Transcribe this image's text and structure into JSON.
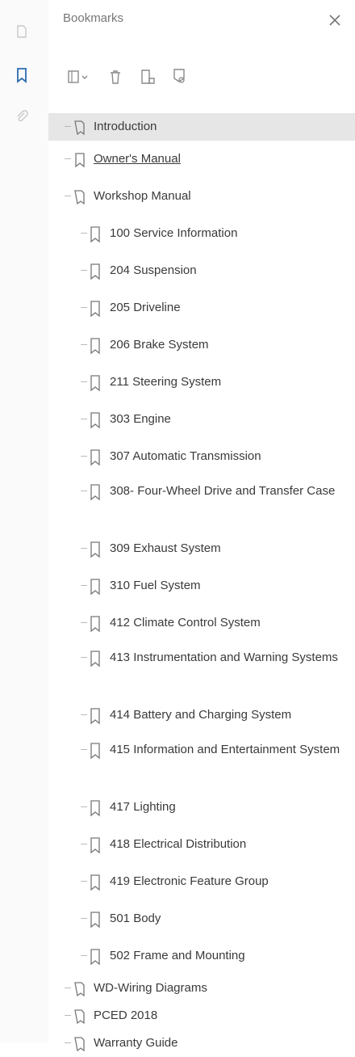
{
  "panel": {
    "title": "Bookmarks",
    "close_icon": "close-icon"
  },
  "rail": {
    "items": [
      {
        "icon": "page-thumbnail-icon"
      },
      {
        "icon": "bookmark-icon"
      },
      {
        "icon": "attachment-icon"
      }
    ]
  },
  "toolbar": {
    "buttons": [
      {
        "icon": "options-menu-icon"
      },
      {
        "icon": "delete-bookmark-icon"
      },
      {
        "icon": "new-bookmark-icon"
      },
      {
        "icon": "find-bookmark-icon"
      }
    ]
  },
  "tree": {
    "top": [
      {
        "label": "Introduction",
        "selected": true
      },
      {
        "label": "Owner's Manual",
        "underlined": true
      },
      {
        "label": "Workshop Manual",
        "expanded": true
      }
    ],
    "workshop_children": [
      "100 Service Information",
      "204 Suspension",
      "205 Driveline",
      "206 Brake System",
      "211 Steering System",
      "303 Engine",
      "307 Automatic Transmission",
      "308- Four-Wheel Drive and Transfer Case",
      "309 Exhaust System",
      "310 Fuel System",
      "412 Climate Control System",
      "413 Instrumentation and Warning Systems",
      "414 Battery and Charging System",
      "415 Information and Entertainment System",
      "417 Lighting",
      "418 Electrical Distribution",
      "419 Electronic Feature Group",
      "501 Body",
      "502 Frame and Mounting"
    ],
    "bottom": [
      {
        "label": "WD-Wiring Diagrams"
      },
      {
        "label": "PCED 2018"
      },
      {
        "label": "Warranty Guide"
      }
    ]
  },
  "colors": {
    "accent": "#2b6cb0",
    "selected_bg": "#e6e6e6",
    "text": "#3a3a3a"
  }
}
